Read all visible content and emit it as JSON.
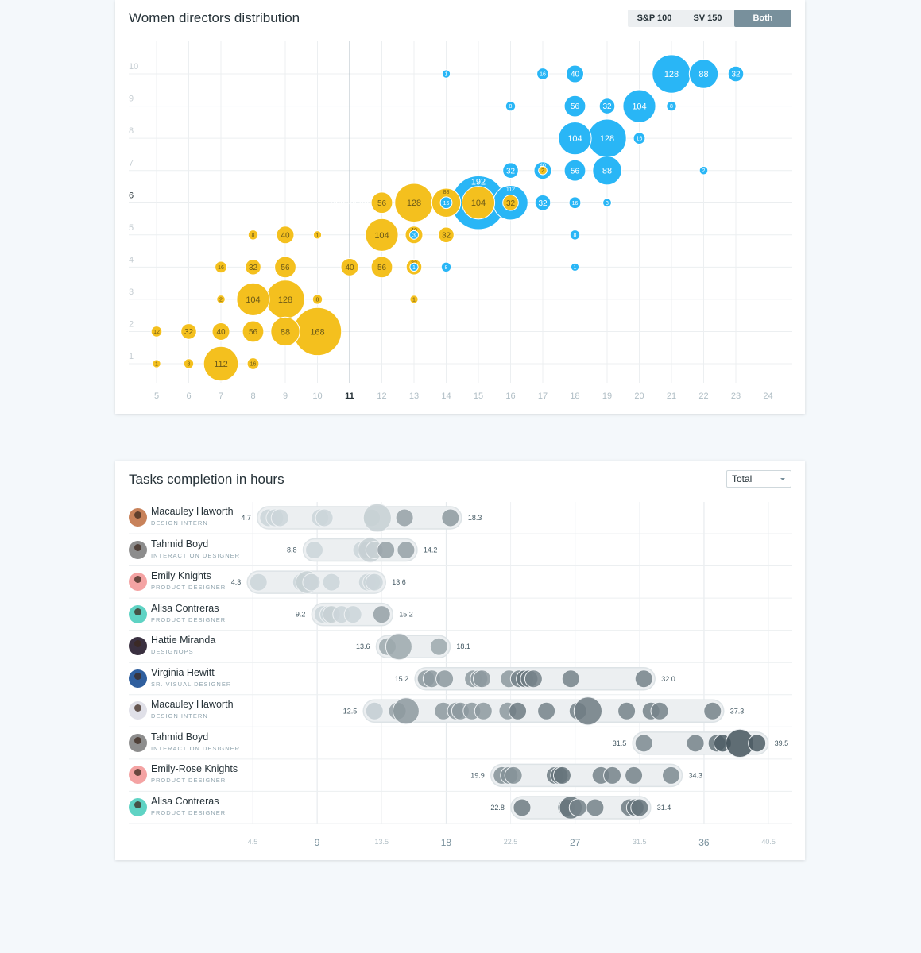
{
  "chart_data": [
    {
      "type": "scatter",
      "subtype": "bubble",
      "title": "Women directors distribution",
      "filters": {
        "options": [
          "S&P 100",
          "SV 150",
          "Both"
        ],
        "selected": "Both"
      },
      "xlim": [
        5,
        24
      ],
      "ylim": [
        1,
        10
      ],
      "x_ticks": [
        5,
        6,
        7,
        8,
        9,
        10,
        11,
        12,
        13,
        14,
        15,
        16,
        17,
        18,
        19,
        20,
        21,
        22,
        23,
        24
      ],
      "y_ticks": [
        1,
        2,
        3,
        4,
        5,
        6,
        7,
        8,
        9,
        10
      ],
      "grid": true,
      "highlight": {
        "x": 11,
        "y": 6,
        "value": 32,
        "color": "#263238"
      },
      "colors": {
        "yellow": "#f4c01e",
        "blue": "#29b6f6"
      },
      "series": [
        {
          "color": "yellow",
          "points": [
            [
              5,
              1,
              1
            ],
            [
              6,
              1,
              8
            ],
            [
              7,
              1,
              112
            ],
            [
              8,
              1,
              16
            ],
            [
              5,
              2,
              12
            ],
            [
              6,
              2,
              32
            ],
            [
              7,
              2,
              40
            ],
            [
              8,
              2,
              56
            ],
            [
              9,
              2,
              88
            ],
            [
              10,
              2,
              168
            ],
            [
              7,
              3,
              2
            ],
            [
              8,
              3,
              104
            ],
            [
              9,
              3,
              128
            ],
            [
              10,
              3,
              8
            ],
            [
              13,
              3,
              1
            ],
            [
              7,
              4,
              16
            ],
            [
              8,
              4,
              32
            ],
            [
              9,
              4,
              56
            ],
            [
              11,
              4,
              40
            ],
            [
              12,
              4,
              56
            ],
            [
              13,
              4,
              32
            ],
            [
              8,
              5,
              8
            ],
            [
              9,
              5,
              40
            ],
            [
              10,
              5,
              1
            ],
            [
              12,
              5,
              104
            ],
            [
              13,
              5,
              40
            ],
            [
              14,
              5,
              32
            ],
            [
              12,
              6,
              56
            ],
            [
              13,
              6,
              128
            ],
            [
              14,
              6,
              88
            ],
            [
              15,
              6,
              104
            ],
            [
              16,
              6,
              32
            ],
            [
              17,
              7,
              2
            ]
          ]
        },
        {
          "color": "blue",
          "points": [
            [
              13,
              4,
              1
            ],
            [
              14,
              4,
              8
            ],
            [
              18,
              4,
              1
            ],
            [
              13,
              5,
              3
            ],
            [
              18,
              5,
              8
            ],
            [
              14,
              6,
              16
            ],
            [
              15,
              6,
              192
            ],
            [
              16,
              6,
              112
            ],
            [
              17,
              6,
              32
            ],
            [
              18,
              6,
              16
            ],
            [
              19,
              6,
              3
            ],
            [
              16,
              7,
              32
            ],
            [
              17,
              7,
              40
            ],
            [
              18,
              7,
              56
            ],
            [
              19,
              7,
              88
            ],
            [
              22,
              7,
              2
            ],
            [
              18,
              8,
              104
            ],
            [
              19,
              8,
              128
            ],
            [
              20,
              8,
              16
            ],
            [
              16,
              9,
              8
            ],
            [
              18,
              9,
              56
            ],
            [
              19,
              9,
              32
            ],
            [
              20,
              9,
              104
            ],
            [
              21,
              9,
              8
            ],
            [
              14,
              10,
              1
            ],
            [
              17,
              10,
              16
            ],
            [
              18,
              10,
              40
            ],
            [
              21,
              10,
              128
            ],
            [
              22,
              10,
              88
            ],
            [
              23,
              10,
              32
            ]
          ]
        }
      ]
    },
    {
      "type": "scatter",
      "subtype": "strip",
      "title": "Tasks completion in hours",
      "dropdown": "Total",
      "xlim": [
        4.5,
        40.5
      ],
      "x_ticks": [
        4.5,
        9,
        13.5,
        18,
        22.5,
        27,
        31.5,
        36,
        40.5
      ],
      "x_ticks_major": [
        9,
        18,
        27,
        36
      ],
      "colors": {
        "light": "#d3dce0",
        "dark": "#37474f",
        "pill": "#eceff1"
      },
      "rows": [
        {
          "name": "Macauley Haworth",
          "role": "DESIGN INTERN",
          "min": "4.7",
          "max": "18.3",
          "avatar": "#c8825a",
          "dots": [
            [
              5.6,
              1,
              0.05
            ],
            [
              6.05,
              1,
              0.05
            ],
            [
              6.4,
              1,
              0.05
            ],
            [
              9.2,
              1,
              0.05
            ],
            [
              9.5,
              1,
              0.05
            ],
            [
              12.8,
              1,
              0.05
            ],
            [
              13.2,
              1.6,
              0.08
            ],
            [
              15.1,
              1,
              0.4
            ],
            [
              18.3,
              1,
              0.45
            ]
          ]
        },
        {
          "name": "Tahmid Boyd",
          "role": "INTERACTION DESIGNER",
          "min": "8.8",
          "max": "14.2",
          "avatar": "#8d8d8d",
          "dots": [
            [
              8.8,
              1,
              0.05
            ],
            [
              12.1,
              1,
              0.05
            ],
            [
              12.5,
              1,
              0.08
            ],
            [
              12.7,
              1.4,
              0.08
            ],
            [
              13.0,
              1,
              0.08
            ],
            [
              13.8,
              1,
              0.4
            ],
            [
              15.2,
              1,
              0.4
            ]
          ]
        },
        {
          "name": "Emily Knights",
          "role": "PRODUCT DESIGNER",
          "min": "4.3",
          "max": "13.6",
          "avatar": "#f4a3a3",
          "dots": [
            [
              4.9,
              1,
              0.05
            ],
            [
              7.9,
              1,
              0.05
            ],
            [
              8.3,
              1.3,
              0.08
            ],
            [
              8.6,
              1,
              0.05
            ],
            [
              10.0,
              1,
              0.05
            ],
            [
              12.5,
              1,
              0.05
            ],
            [
              12.8,
              1,
              0.05
            ],
            [
              13.0,
              1,
              0.05
            ]
          ]
        },
        {
          "name": "Alisa Contreras",
          "role": "PRODUCT DESIGNER",
          "min": "9.2",
          "max": "15.2",
          "avatar": "#5fd3c4",
          "dots": [
            [
              9.4,
              1,
              0.05
            ],
            [
              9.8,
              1,
              0.05
            ],
            [
              10.0,
              1,
              0.08
            ],
            [
              10.7,
              1,
              0.05
            ],
            [
              11.5,
              1,
              0.05
            ],
            [
              13.5,
              1,
              0.4
            ]
          ]
        },
        {
          "name": "Hattie Miranda",
          "role": "DESIGNOPS",
          "min": "13.6",
          "max": "18.1",
          "avatar": "#3a3040",
          "dots": [
            [
              13.9,
              1,
              0.35
            ],
            [
              14.7,
              1.5,
              0.35
            ],
            [
              17.5,
              1,
              0.35
            ]
          ]
        },
        {
          "name": "Virginia Hewitt",
          "role": "SR. VISUAL DESIGNER",
          "min": "15.2",
          "max": "32.0",
          "avatar": "#2f5f9e",
          "dots": [
            [
              16.6,
              1,
              0.45
            ],
            [
              17.0,
              1,
              0.45
            ],
            [
              17.9,
              1,
              0.45
            ],
            [
              19.9,
              1,
              0.45
            ],
            [
              20.3,
              1,
              0.45
            ],
            [
              20.5,
              1,
              0.45
            ],
            [
              22.4,
              1,
              0.45
            ],
            [
              23.1,
              1,
              0.6
            ],
            [
              23.5,
              1,
              0.7
            ],
            [
              23.8,
              1,
              0.65
            ],
            [
              24.1,
              1,
              0.6
            ],
            [
              26.7,
              1,
              0.6
            ],
            [
              31.8,
              1,
              0.6
            ]
          ]
        },
        {
          "name": "Macauley Haworth",
          "role": "DESIGN INTERN",
          "min": "12.5",
          "max": "37.3",
          "avatar": "#e0e0e8",
          "dots": [
            [
              13.0,
              1,
              0.1
            ],
            [
              14.6,
              1,
              0.4
            ],
            [
              15.2,
              1.5,
              0.45
            ],
            [
              17.8,
              1,
              0.45
            ],
            [
              18.7,
              1,
              0.45
            ],
            [
              19.0,
              1,
              0.45
            ],
            [
              19.8,
              1,
              0.45
            ],
            [
              20.6,
              1,
              0.45
            ],
            [
              22.3,
              1,
              0.45
            ],
            [
              23.0,
              1,
              0.65
            ],
            [
              25.0,
              1,
              0.6
            ],
            [
              27.2,
              1,
              0.6
            ],
            [
              27.9,
              1.6,
              0.65
            ],
            [
              30.6,
              1,
              0.6
            ],
            [
              32.3,
              1,
              0.6
            ],
            [
              32.9,
              1,
              0.6
            ],
            [
              36.6,
              1,
              0.6
            ]
          ]
        },
        {
          "name": "Tahmid Boyd",
          "role": "INTERACTION DESIGNER",
          "min": "31.5",
          "max": "39.5",
          "avatar": "#8d8d8d",
          "dots": [
            [
              31.8,
              1,
              0.55
            ],
            [
              35.4,
              1,
              0.6
            ],
            [
              36.9,
              1,
              0.7
            ],
            [
              37.3,
              1,
              0.85
            ],
            [
              38.5,
              1.6,
              0.9
            ],
            [
              39.7,
              1,
              0.85
            ]
          ]
        },
        {
          "name": "Emily-Rose Knights",
          "role": "PRODUCT DESIGNER",
          "min": "19.9",
          "max": "34.3",
          "avatar": "#f4a3a3",
          "dots": [
            [
              21.9,
              1,
              0.5
            ],
            [
              22.4,
              1,
              0.5
            ],
            [
              22.7,
              1,
              0.5
            ],
            [
              25.6,
              1,
              0.65
            ],
            [
              25.9,
              1,
              0.7
            ],
            [
              26.1,
              1,
              0.7
            ],
            [
              28.8,
              1,
              0.6
            ],
            [
              29.6,
              1,
              0.6
            ],
            [
              31.1,
              1,
              0.6
            ],
            [
              33.7,
              1,
              0.55
            ]
          ]
        },
        {
          "name": "Alisa Contreras",
          "role": "PRODUCT DESIGNER",
          "min": "22.8",
          "max": "31.4",
          "avatar": "#5fd3c4",
          "dots": [
            [
              23.3,
              1,
              0.65
            ],
            [
              26.4,
              1,
              0.65
            ],
            [
              26.7,
              1.3,
              0.7
            ],
            [
              27.2,
              1,
              0.6
            ],
            [
              28.4,
              1,
              0.6
            ],
            [
              30.8,
              1,
              0.65
            ],
            [
              31.2,
              1,
              0.7
            ],
            [
              31.5,
              1,
              0.7
            ]
          ]
        }
      ]
    }
  ]
}
